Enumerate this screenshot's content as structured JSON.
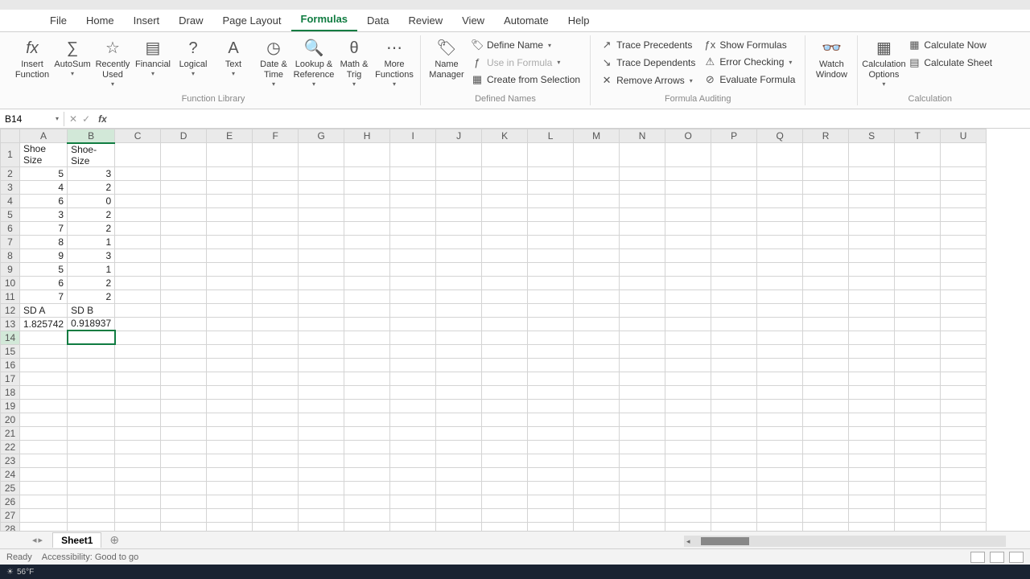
{
  "tabs": {
    "file": "File",
    "home": "Home",
    "insert": "Insert",
    "draw": "Draw",
    "page_layout": "Page Layout",
    "formulas": "Formulas",
    "data": "Data",
    "review": "Review",
    "view": "View",
    "automate": "Automate",
    "help": "Help"
  },
  "ribbon": {
    "insert_function": "Insert Function",
    "autosum": "AutoSum",
    "recently_used": "Recently Used",
    "financial": "Financial",
    "logical": "Logical",
    "text": "Text",
    "date_time": "Date & Time",
    "lookup_ref": "Lookup & Reference",
    "math_trig": "Math & Trig",
    "more_functions": "More Functions",
    "group_function_library": "Function Library",
    "name_manager": "Name Manager",
    "define_name": "Define Name",
    "use_in_formula": "Use in Formula",
    "create_from_selection": "Create from Selection",
    "group_defined_names": "Defined Names",
    "trace_precedents": "Trace Precedents",
    "trace_dependents": "Trace Dependents",
    "remove_arrows": "Remove Arrows",
    "show_formulas": "Show Formulas",
    "error_checking": "Error Checking",
    "evaluate_formula": "Evaluate Formula",
    "group_formula_auditing": "Formula Auditing",
    "watch_window": "Watch Window",
    "calc_options": "Calculation Options",
    "calc_now": "Calculate Now",
    "calc_sheet": "Calculate Sheet",
    "group_calculation": "Calculation"
  },
  "namebox": "B14",
  "columns": [
    "A",
    "B",
    "C",
    "D",
    "E",
    "F",
    "G",
    "H",
    "I",
    "J",
    "K",
    "L",
    "M",
    "N",
    "O",
    "P",
    "Q",
    "R",
    "S",
    "T",
    "U"
  ],
  "rows_visible": 28,
  "selected_cell": {
    "row": 14,
    "col": 1
  },
  "cells": {
    "A1": "Shoe Size",
    "B1": "Shoe-Size",
    "A2": "5",
    "B2": "3",
    "A3": "4",
    "B3": "2",
    "A4": "6",
    "B4": "0",
    "A5": "3",
    "B5": "2",
    "A6": "7",
    "B6": "2",
    "A7": "8",
    "B7": "1",
    "A8": "9",
    "B8": "3",
    "A9": "5",
    "B9": "1",
    "A10": "6",
    "B10": "2",
    "A11": "7",
    "B11": "2",
    "A12": "SD A",
    "B12": "SD B",
    "A13": "1.825742",
    "B13": "0.918937"
  },
  "text_cells": [
    "A1",
    "B1",
    "A12",
    "B12"
  ],
  "sheet": {
    "name": "Sheet1"
  },
  "status": {
    "ready": "Ready",
    "accessibility": "Accessibility: Good to go"
  },
  "taskbar": {
    "temp": "56°F"
  }
}
